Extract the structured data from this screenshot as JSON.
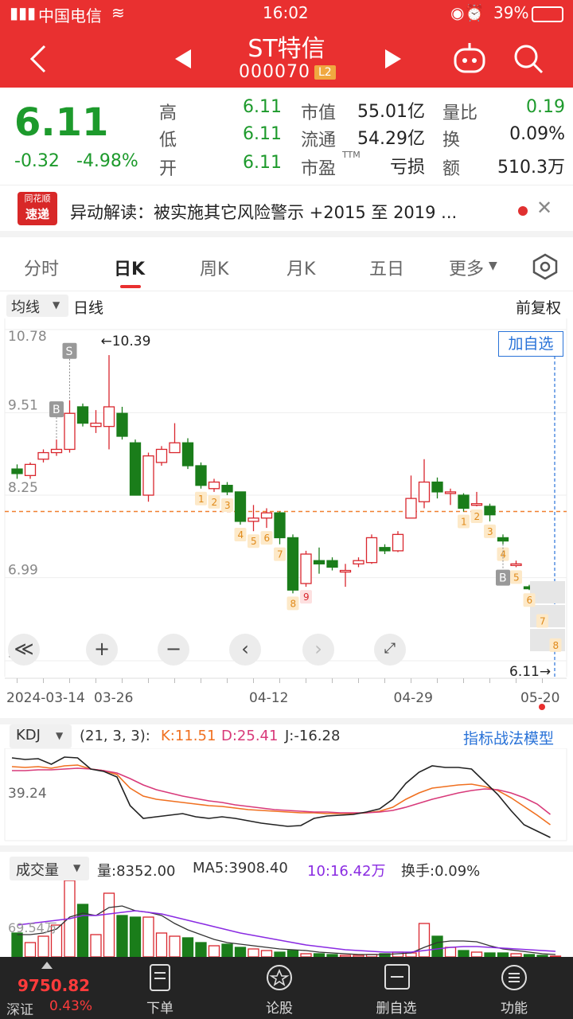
{
  "status_bar": {
    "carrier": "中国电信",
    "time": "16:02",
    "battery": "39%"
  },
  "header": {
    "title": "ST特信",
    "code": "000070",
    "level_badge": "L2"
  },
  "quote": {
    "price": "6.11",
    "change": "-0.32",
    "change_pct": "-4.98%",
    "fields": [
      {
        "label": "高",
        "value": "6.11"
      },
      {
        "label": "低",
        "value": "6.11"
      },
      {
        "label": "开",
        "value": "6.11"
      },
      {
        "label": "市值",
        "value": "55.01亿"
      },
      {
        "label": "流通",
        "value": "54.29亿"
      },
      {
        "label": "市盈",
        "value": "亏损",
        "sup": "TTM"
      },
      {
        "label": "量比",
        "value": "0.19"
      },
      {
        "label": "换",
        "value": "0.09%"
      },
      {
        "label": "额",
        "value": "510.3万"
      }
    ]
  },
  "news": {
    "logo_top": "同花顺",
    "logo_bottom": "速递",
    "text": "异动解读：被实施其它风险警示 +2015 至 2019 ..."
  },
  "tabs": [
    "分时",
    "日K",
    "周K",
    "月K",
    "五日",
    "更多"
  ],
  "chart_header": {
    "ma_label": "均线",
    "period": "日线",
    "adjust": "前复权",
    "add_watch": "加自选"
  },
  "chart_data": {
    "type": "candlestick",
    "y_ticks": [
      "10.78",
      "9.51",
      "8.25",
      "6.99",
      "5.72"
    ],
    "ylim": [
      5.72,
      10.78
    ],
    "reference_line": 8.0,
    "max_label": "←10.39",
    "last_label": "6.11→",
    "x_ticks": [
      "2024-03-14",
      "03-26",
      "04-12",
      "04-29",
      "05-20"
    ],
    "candles": [
      [
        8.65,
        8.58,
        8.72,
        8.5
      ],
      [
        8.55,
        8.72,
        8.75,
        8.5
      ],
      [
        8.8,
        8.9,
        8.95,
        8.75
      ],
      [
        8.9,
        8.95,
        9.1,
        8.85
      ],
      [
        8.95,
        9.5,
        9.7,
        8.9
      ],
      [
        9.6,
        9.35,
        9.65,
        9.3
      ],
      [
        9.3,
        9.35,
        9.55,
        9.2
      ],
      [
        9.3,
        9.6,
        10.39,
        8.95
      ],
      [
        9.5,
        9.15,
        9.6,
        9.1
      ],
      [
        9.05,
        8.25,
        9.1,
        8.25
      ],
      [
        8.25,
        8.85,
        8.9,
        8.15
      ],
      [
        8.75,
        8.95,
        9.0,
        8.7
      ],
      [
        8.9,
        9.05,
        9.35,
        8.9
      ],
      [
        9.05,
        8.7,
        9.12,
        8.65
      ],
      [
        8.7,
        8.4,
        8.75,
        8.35
      ],
      [
        8.35,
        8.45,
        8.5,
        8.3
      ],
      [
        8.4,
        8.3,
        8.45,
        8.25
      ],
      [
        8.3,
        7.85,
        8.3,
        7.8
      ],
      [
        7.85,
        7.9,
        8.1,
        7.7
      ],
      [
        7.9,
        7.98,
        8.05,
        7.75
      ],
      [
        7.98,
        7.6,
        8.0,
        7.5
      ],
      [
        7.6,
        6.8,
        7.65,
        6.75
      ],
      [
        6.9,
        7.35,
        7.4,
        6.85
      ],
      [
        7.25,
        7.2,
        7.45,
        7.05
      ],
      [
        7.25,
        7.15,
        7.3,
        7.1
      ],
      [
        7.1,
        7.1,
        7.2,
        6.85
      ],
      [
        7.2,
        7.25,
        7.3,
        7.15
      ],
      [
        7.22,
        7.6,
        7.65,
        7.2
      ],
      [
        7.45,
        7.4,
        7.5,
        7.35
      ],
      [
        7.4,
        7.65,
        7.7,
        7.38
      ],
      [
        7.9,
        8.2,
        8.55,
        7.9
      ],
      [
        8.15,
        8.45,
        8.8,
        8.05
      ],
      [
        8.45,
        8.3,
        8.52,
        8.2
      ],
      [
        8.28,
        8.3,
        8.35,
        8.1
      ],
      [
        8.25,
        8.05,
        8.28,
        8.0
      ],
      [
        8.1,
        8.12,
        8.3,
        8.08
      ],
      [
        8.08,
        7.95,
        8.12,
        7.85
      ],
      [
        7.6,
        7.55,
        7.65,
        7.5
      ],
      [
        7.2,
        7.2,
        7.25,
        7.15
      ],
      [
        6.85,
        6.82,
        6.88,
        6.8
      ],
      [
        6.52,
        6.5,
        6.55,
        6.48
      ],
      [
        6.11,
        6.11,
        6.11,
        6.11
      ]
    ],
    "signals": [
      {
        "i": 3,
        "t": "B"
      },
      {
        "i": 4,
        "t": "S"
      },
      {
        "i": 37,
        "t": "B"
      }
    ],
    "counts": [
      {
        "i": 14,
        "t": "1"
      },
      {
        "i": 15,
        "t": "2"
      },
      {
        "i": 16,
        "t": "3"
      },
      {
        "i": 17,
        "t": "4"
      },
      {
        "i": 18,
        "t": "5"
      },
      {
        "i": 19,
        "t": "6"
      },
      {
        "i": 20,
        "t": "7"
      },
      {
        "i": 21,
        "t": "8"
      },
      {
        "i": 22,
        "t": "9"
      },
      {
        "i": 34,
        "t": "1"
      },
      {
        "i": 35,
        "t": "2"
      },
      {
        "i": 36,
        "t": "3"
      },
      {
        "i": 37,
        "t": "4"
      },
      {
        "i": 38,
        "t": "5"
      },
      {
        "i": 39,
        "t": "6"
      },
      {
        "i": 40,
        "t": "7"
      },
      {
        "i": 41,
        "t": "8"
      }
    ]
  },
  "kdj": {
    "name": "KDJ",
    "params": "(21, 3, 3):",
    "k": "K:11.51",
    "d": "D:25.41",
    "j": "J:-16.28",
    "level": "39.24",
    "link": "指标战法模型"
  },
  "volume": {
    "name": "成交量",
    "vol": "量:8352.00",
    "ma5": "MA5:3908.40",
    "ma10": "10:16.42万",
    "turnover": "换手:0.09%",
    "axis_label": "69.54万"
  },
  "colors": {
    "up": "#d9272e",
    "down": "#1a7d1a",
    "header": "#e93030",
    "blue": "#2a73d8"
  },
  "bottom": {
    "index_value": "9750.82",
    "index_name": "深证",
    "index_pct": "0.43%",
    "items": [
      "下单",
      "论股",
      "删自选",
      "功能"
    ]
  }
}
